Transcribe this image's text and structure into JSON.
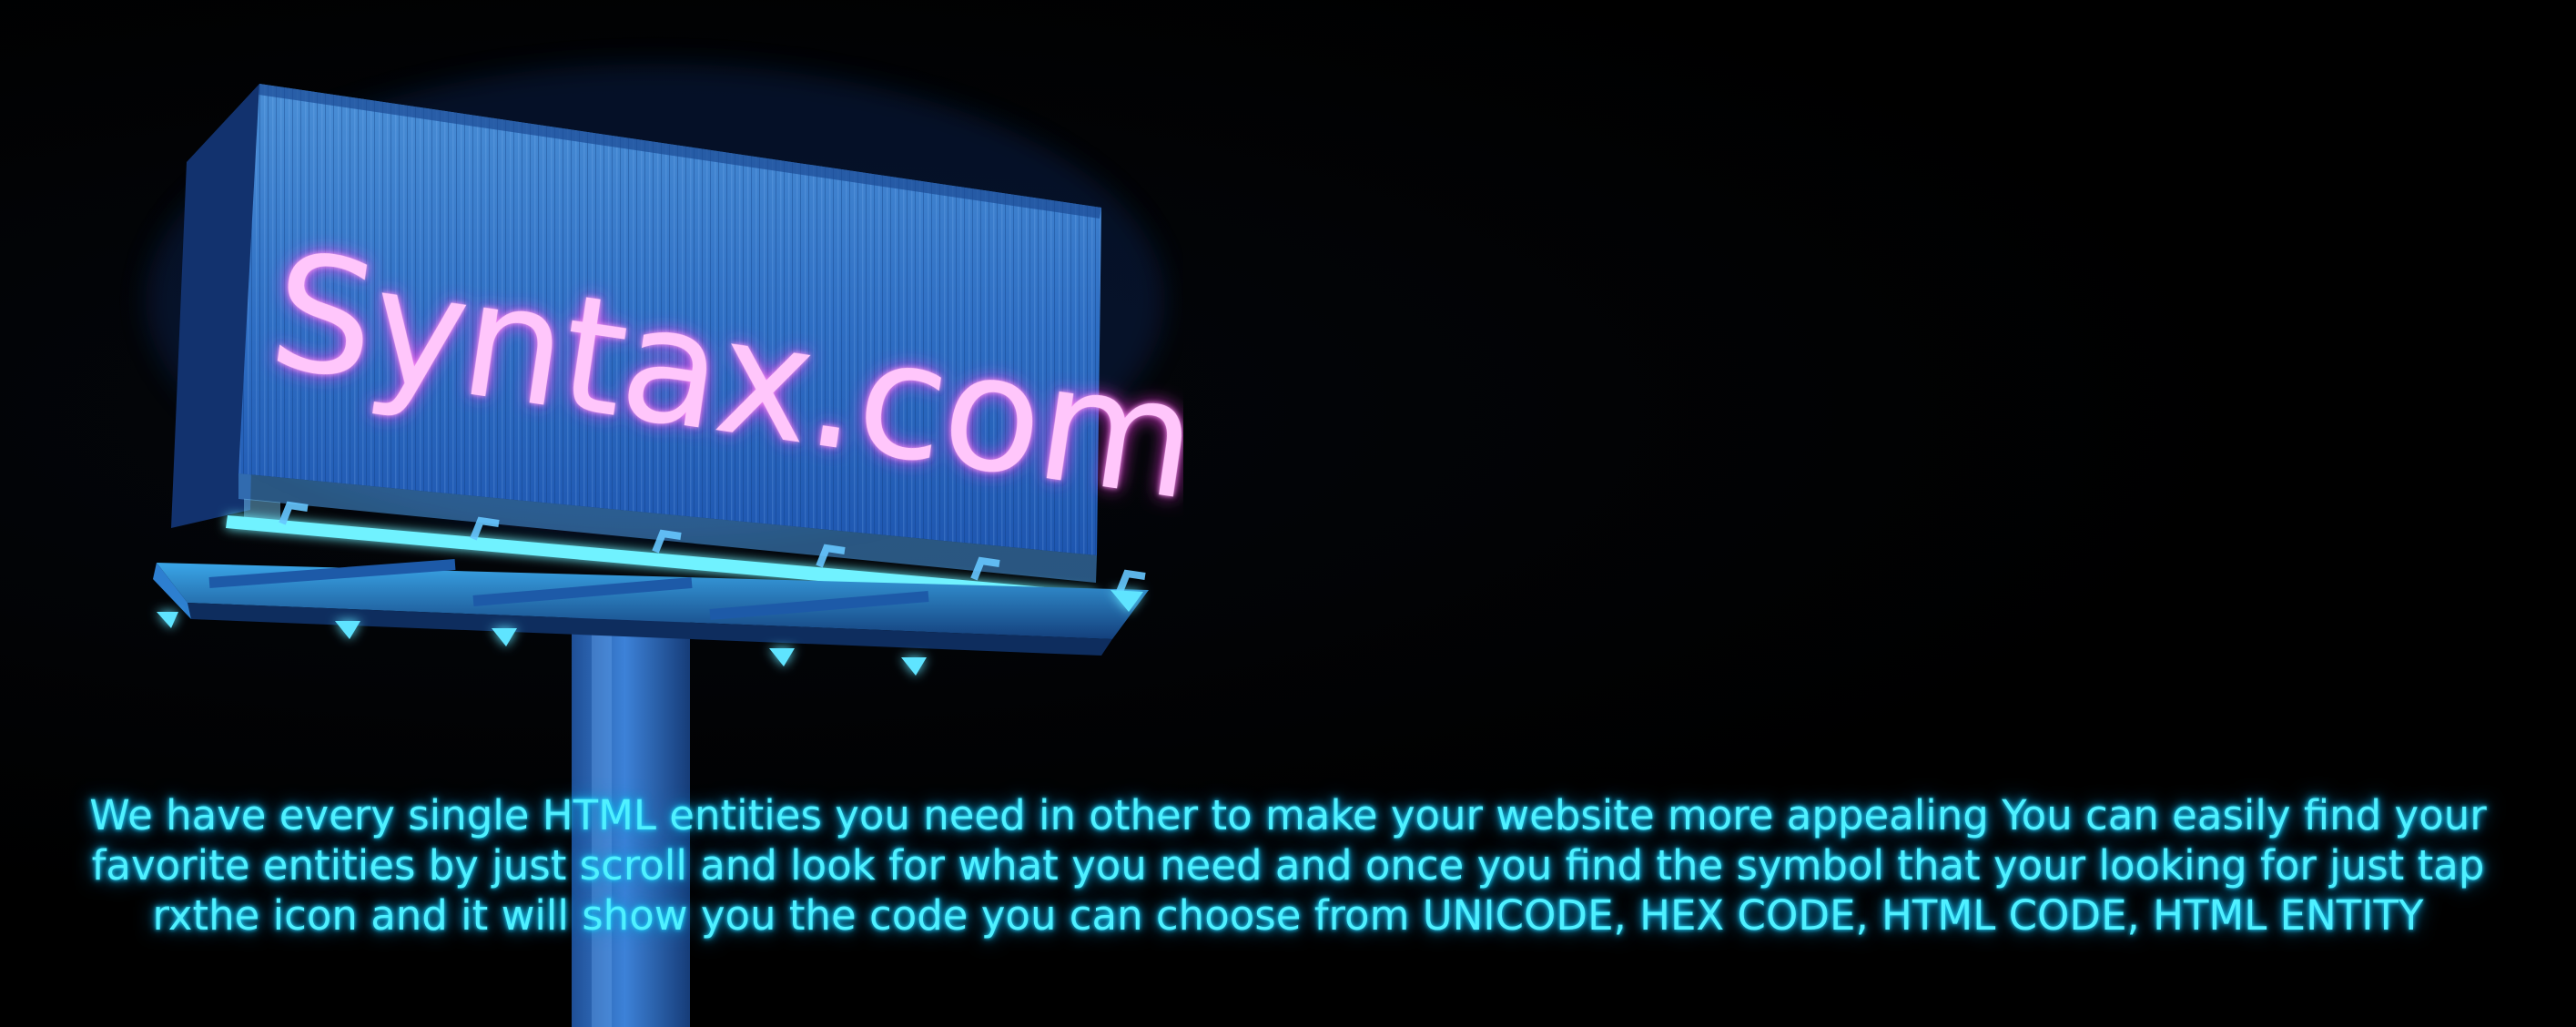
{
  "billboard": {
    "sign_text": "Syntax.com"
  },
  "description": {
    "text": "We have every single HTML entities you need in other to make your website more appealing You can easily find your favorite entities by just scroll and look for what you need and once you find the symbol that your looking for just tap rxthe icon and it will show you the code you can choose from UNICODE, HEX CODE, HTML CODE, HTML ENTITY"
  },
  "colors": {
    "background": "#000000",
    "billboard_blue": "#2f7bd8",
    "neon_pink": "#ff7bf2",
    "neon_cyan": "#4ff0ff"
  }
}
